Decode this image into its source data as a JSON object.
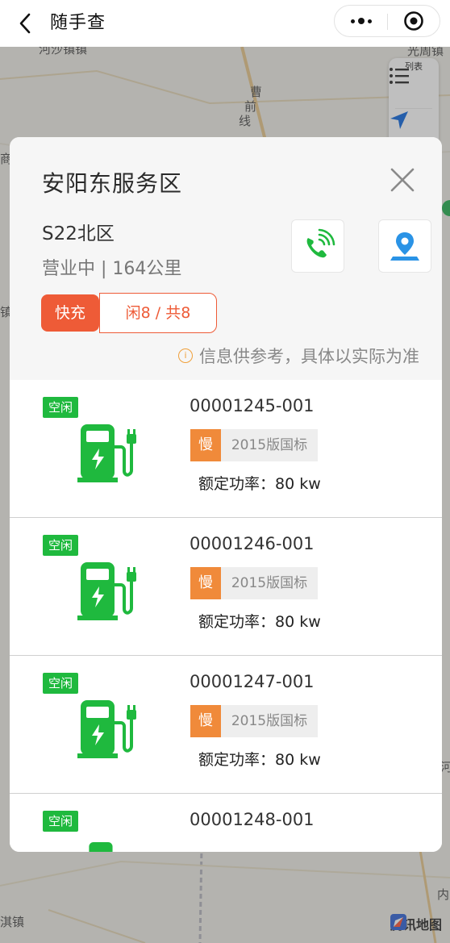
{
  "nav": {
    "title": "随手查",
    "back_icon": "chevron-left-icon",
    "more_icon": "more-dots-icon",
    "close_icon": "target-circle-icon"
  },
  "map": {
    "labels": [
      "河沙镇镇",
      "光周镇",
      "曹",
      "前",
      "线",
      "商",
      "镇",
      "河",
      "内",
      "淇镇"
    ],
    "list_button_label": "列表",
    "provider": "腾讯地图"
  },
  "station": {
    "name": "安阳东服务区",
    "zone": "S22北区",
    "status": "营业中 | 164公里",
    "fast_tag": "快充",
    "count_tag": "闲8 / 共8",
    "notice": "信息供参考，具体以实际为准",
    "accent_color": "#ee5b37"
  },
  "chargers": [
    {
      "status": "空闲",
      "code": "00001245-001",
      "speed": "慢",
      "standard": "2015版国标",
      "power": "额定功率：80 kw"
    },
    {
      "status": "空闲",
      "code": "00001246-001",
      "speed": "慢",
      "standard": "2015版国标",
      "power": "额定功率：80 kw"
    },
    {
      "status": "空闲",
      "code": "00001247-001",
      "speed": "慢",
      "standard": "2015版国标",
      "power": "额定功率：80 kw"
    },
    {
      "status": "空闲",
      "code": "00001248-001"
    }
  ],
  "colors": {
    "idle_green": "#1fb93e",
    "slow_orange": "#f08a3a",
    "phone_green": "#1fb93e",
    "nav_blue": "#2a93e6"
  }
}
